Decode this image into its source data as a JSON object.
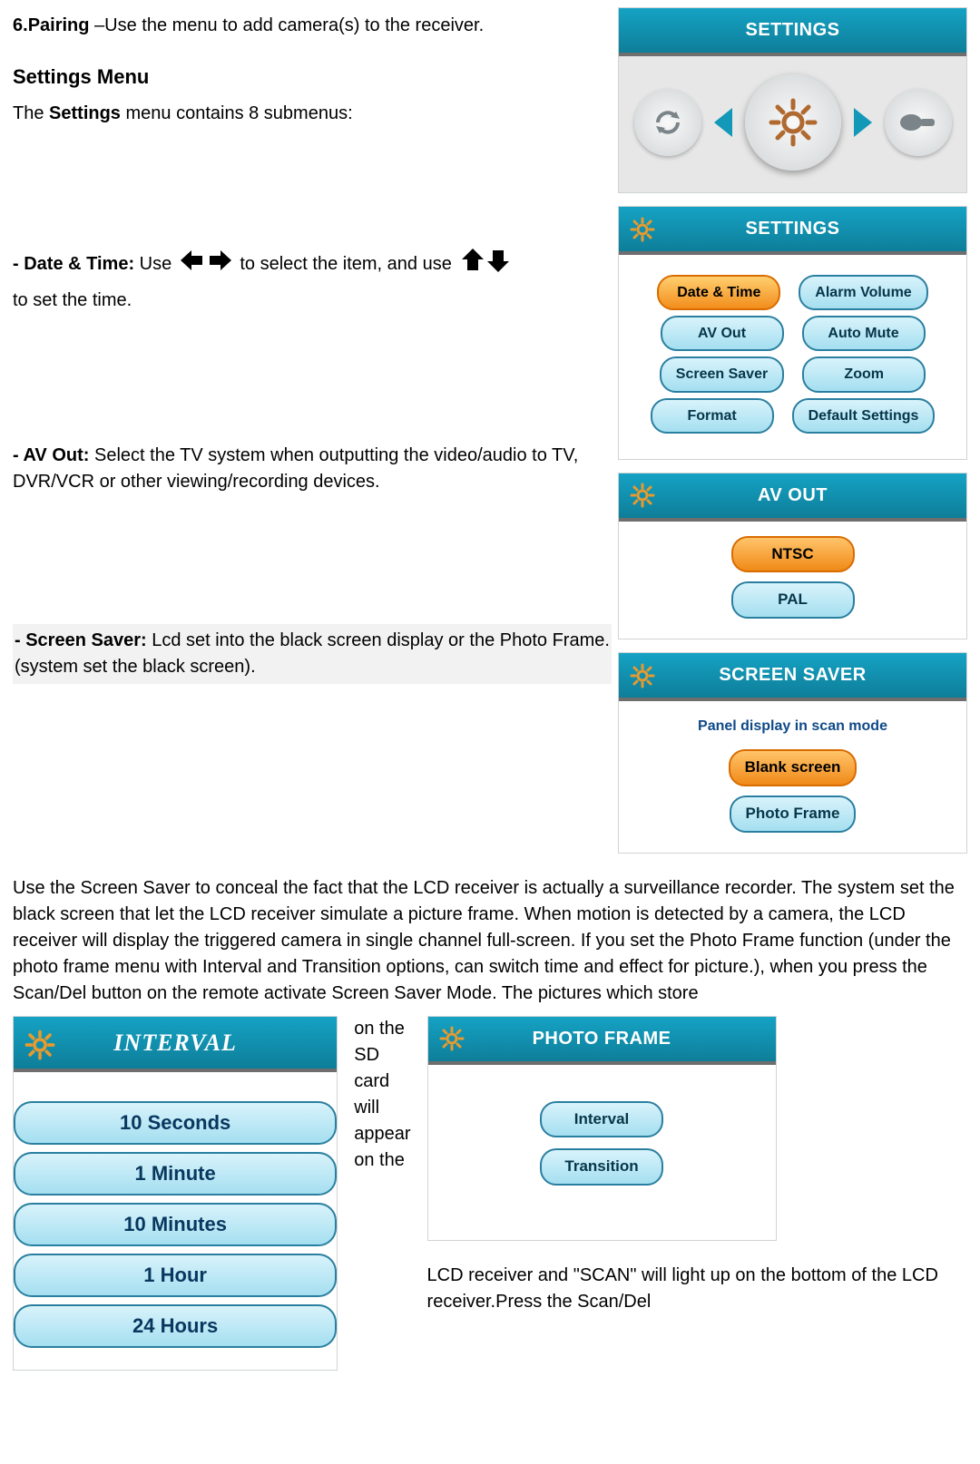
{
  "pairing": {
    "num": "6.",
    "label": "Pairing",
    "text": " –Use the menu to add camera(s) to the receiver."
  },
  "settings_menu": {
    "title": "Settings Menu",
    "intro_pre": "The ",
    "intro_bold": "Settings",
    "intro_post": " menu contains 8 submenus:"
  },
  "date_time": {
    "label": "- Date & Time:",
    "t1": " Use ",
    "t2": " to select the item, and use ",
    "t3": "to set the time."
  },
  "left_right_icon": "left-right-arrows-icon",
  "down_up_icon": "down-up-arrows-icon",
  "av_out_desc": {
    "label": "- AV Out:",
    "text": " Select the TV system when outputting the video/audio to TV, DVR/VCR or other viewing/recording devices."
  },
  "screen_saver_desc": {
    "label": "- Screen Saver:",
    "text": " Lcd set into the black screen display or the Photo Frame.(system set the black screen)."
  },
  "long_para": "Use the Screen Saver to conceal the fact that the LCD receiver is actually a surveillance recorder. The system set the black screen that let the LCD receiver simulate a picture frame. When motion is detected by a camera, the LCD receiver will display the triggered camera in single channel full-screen. If you set the Photo Frame function (under the photo frame menu with Interval and Transition options, can switch time and effect for picture.), when you press the Scan/Del button on the remote activate Screen Saver Mode. The pictures which store",
  "narrow_text": "on the SD card will appear on the",
  "tail_text": "LCD receiver and \"SCAN\" will light up on the bottom of the LCD receiver.Press the Scan/Del",
  "top_panel": {
    "title": "SETTINGS"
  },
  "settings_panel": {
    "title": "SETTINGS",
    "buttons": [
      [
        "Date & Time",
        "Alarm Volume"
      ],
      [
        "AV Out",
        "Auto Mute"
      ],
      [
        "Screen Saver",
        "Zoom"
      ],
      [
        "Format",
        "Default Settings"
      ]
    ],
    "selected": "Date & Time"
  },
  "avout_panel": {
    "title": "AV OUT",
    "options": [
      "NTSC",
      "PAL"
    ],
    "selected": "NTSC"
  },
  "screensaver_panel": {
    "title": "SCREEN SAVER",
    "subtitle": "Panel display in scan mode",
    "options": [
      "Blank screen",
      "Photo Frame"
    ],
    "selected": "Blank screen"
  },
  "photoframe_panel": {
    "title": "PHOTO FRAME",
    "options": [
      "Interval",
      "Transition"
    ]
  },
  "interval_panel": {
    "title": "INTERVAL",
    "options": [
      "10 Seconds",
      "1 Minute",
      "10 Minutes",
      "1 Hour",
      "24 Hours"
    ]
  }
}
